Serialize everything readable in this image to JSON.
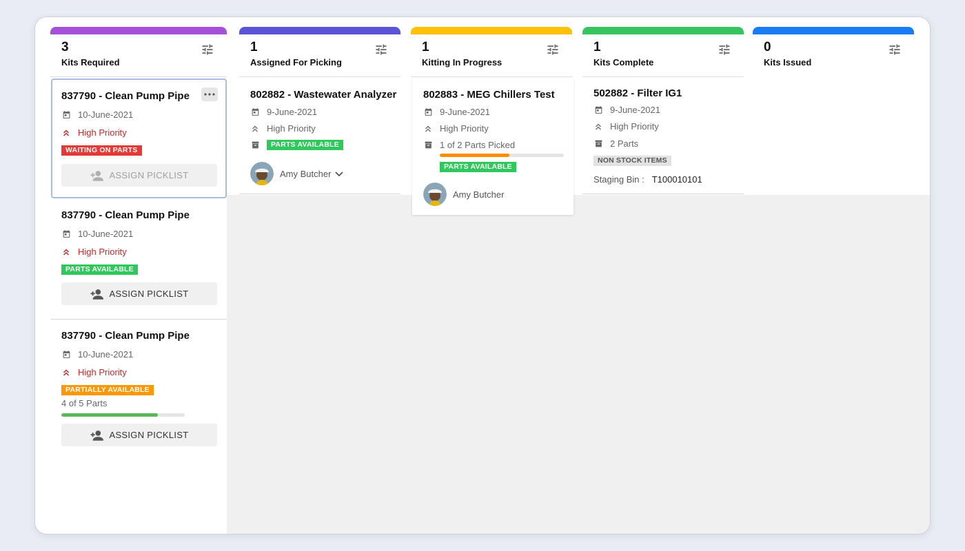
{
  "columns": [
    {
      "count": "3",
      "title": "Kits Required",
      "color": "#a64fd8"
    },
    {
      "count": "1",
      "title": "Assigned For Picking",
      "color": "#5b54d6"
    },
    {
      "count": "1",
      "title": "Kitting In Progress",
      "color": "#ffc107"
    },
    {
      "count": "1",
      "title": "Kits Complete",
      "color": "#37c45f"
    },
    {
      "count": "0",
      "title": "Kits Issued",
      "color": "#1a7cf2"
    }
  ],
  "kits_required": [
    {
      "title": "837790 - Clean Pump Pipe",
      "date": "10-June-2021",
      "priority": "High Priority",
      "badge": "WAITING ON PARTS",
      "button": "ASSIGN PICKLIST"
    },
    {
      "title": "837790 - Clean Pump Pipe",
      "date": "10-June-2021",
      "priority": "High Priority",
      "badge": "PARTS AVAILABLE",
      "button": "ASSIGN PICKLIST"
    },
    {
      "title": "837790 - Clean Pump Pipe",
      "date": "10-June-2021",
      "priority": "High Priority",
      "badge": "PARTIALLY AVAILABLE",
      "parts": "4 of 5 Parts",
      "parts_progress": 0.78,
      "button": "ASSIGN PICKLIST"
    }
  ],
  "assigned": {
    "title": "802882 - Wastewater Analyzer",
    "date": "9-June-2021",
    "priority": "High Priority",
    "badge": "PARTS AVAILABLE",
    "assignee": "Amy Butcher"
  },
  "in_progress": {
    "title": "802883 - MEG Chillers Test",
    "date": "9-June-2021",
    "priority": "High Priority",
    "parts": "1 of 2 Parts Picked",
    "parts_progress": 0.56,
    "badge": "PARTS AVAILABLE",
    "assignee": "Amy Butcher"
  },
  "complete": {
    "title": "502882 - Filter IG1",
    "date": "9-June-2021",
    "priority": "High Priority",
    "parts": "2 Parts",
    "badge": "NON STOCK ITEMS",
    "staging_label": "Staging Bin :",
    "staging_value": "T100010101"
  },
  "colors": {
    "progress_green": "#5cb85c",
    "progress_orange": "#ff8c00",
    "priority_red": "#c62828"
  }
}
